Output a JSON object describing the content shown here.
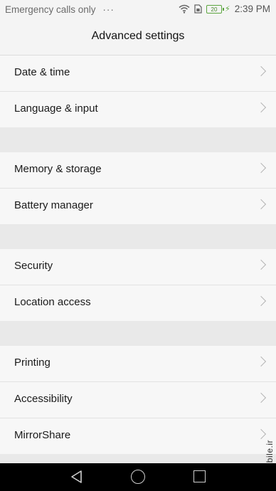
{
  "status": {
    "left_text": "Emergency calls only",
    "dots": "···",
    "battery": "20",
    "time": "2:39 PM",
    "icons": [
      "wifi-icon",
      "sim-icon",
      "battery-icon",
      "charging-icon"
    ]
  },
  "header": {
    "title": "Advanced settings"
  },
  "groups": [
    {
      "items": [
        "Date & time",
        "Language & input"
      ]
    },
    {
      "items": [
        "Memory & storage",
        "Battery manager"
      ]
    },
    {
      "items": [
        "Security",
        "Location access"
      ]
    },
    {
      "items": [
        "Printing",
        "Accessibility",
        "MirrorShare"
      ]
    }
  ],
  "watermark": "mobile.ir",
  "nav": [
    "back-icon",
    "home-icon",
    "recents-icon"
  ]
}
